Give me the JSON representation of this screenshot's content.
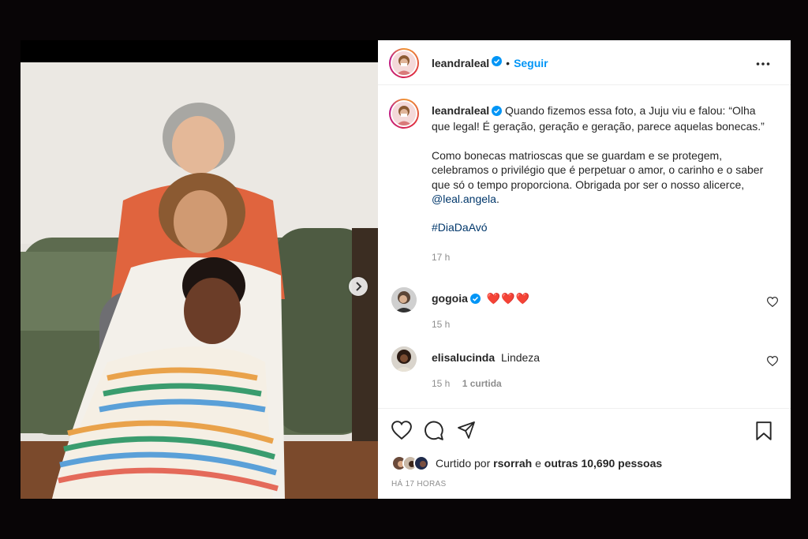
{
  "post": {
    "username": "leandraleal",
    "follow_label": "Seguir",
    "separator": "•",
    "caption_line1": "Quando fizemos essa foto, a Juju viu e falou: “Olha que legal! É geração, geração e geração, parece aquelas bonecas.”",
    "caption_line2": "Como bonecas matrioscas que se guardam e se protegem, celebramos o privilégio que é perpetuar o amor, o carinho e o saber que só o tempo proporciona. Obrigada por ser o nosso alicerce,",
    "mention": "@leal.angela",
    "mention_suffix": ".",
    "hashtag": "#DiaDaAvó",
    "caption_time": "17 h"
  },
  "comments": [
    {
      "username": "gogoia",
      "text": "❤️❤️❤️",
      "time": "15 h",
      "likes": ""
    },
    {
      "username": "elisalucinda",
      "text": "Lindeza",
      "time": "15 h",
      "likes": "1 curtida"
    }
  ],
  "likes": {
    "prefix": "Curtido por",
    "user": "rsorrah",
    "middle": "e",
    "others": "outras 10,690 pessoas"
  },
  "date_label": "HÁ 17 HORAS",
  "icons": {
    "more": "more-horizontal-icon",
    "like": "heart-icon",
    "comment": "comment-icon",
    "share": "send-icon",
    "save": "bookmark-icon",
    "next": "chevron-right-icon",
    "verified": "verified-badge-icon"
  },
  "colors": {
    "accent": "#0095f6",
    "heart": "#ed4956",
    "background": "#080506"
  }
}
